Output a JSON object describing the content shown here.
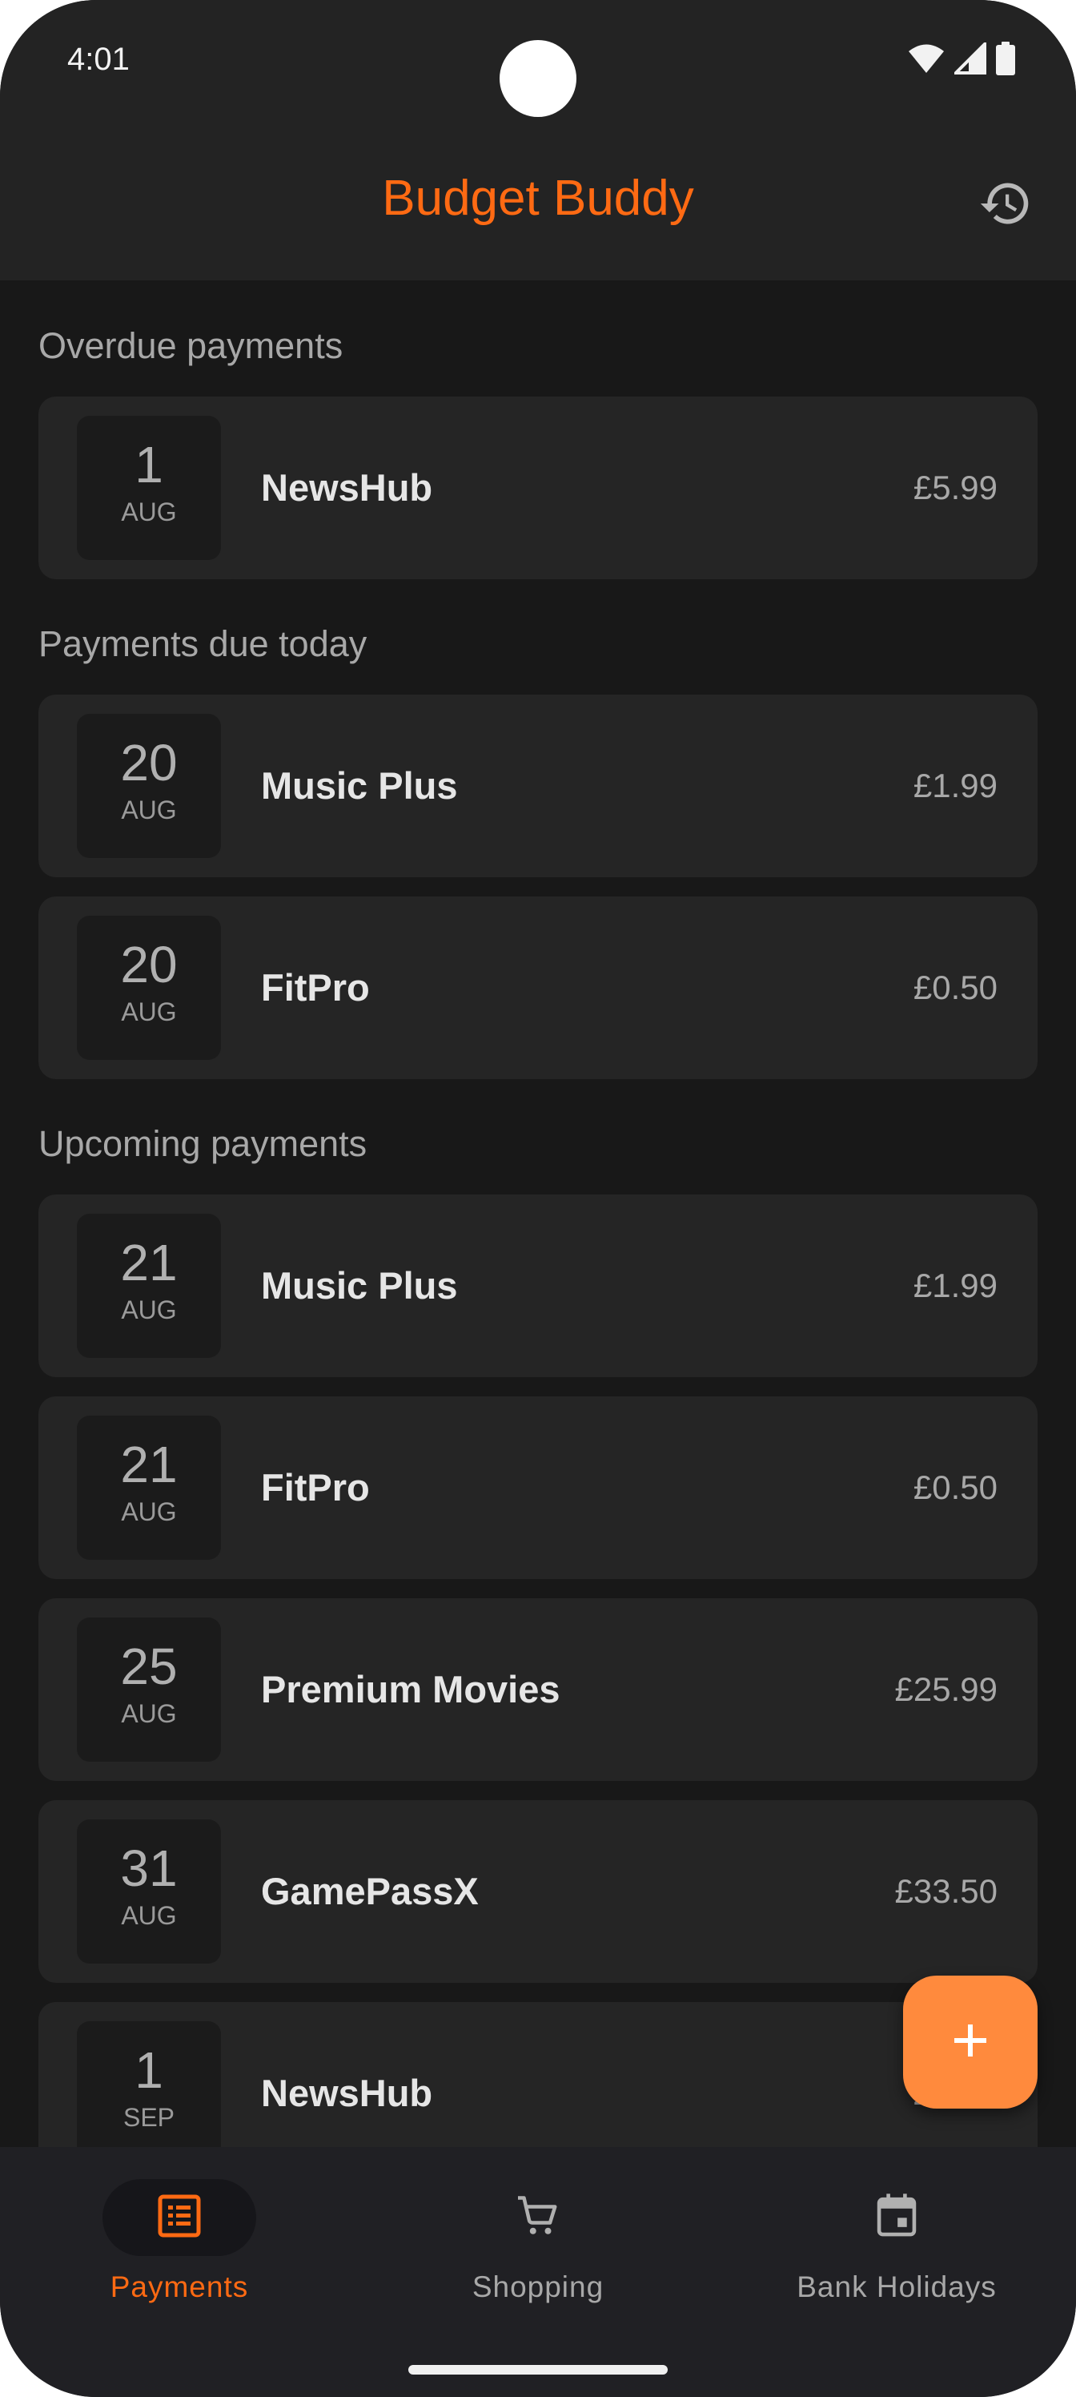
{
  "status_bar": {
    "time": "4:01"
  },
  "app_bar": {
    "title": "Budget Buddy",
    "history_icon": "history-icon"
  },
  "sections": {
    "overdue": {
      "title": "Overdue payments",
      "items": [
        {
          "day": "1",
          "month": "AUG",
          "name": "NewsHub",
          "amount": "£5.99"
        }
      ]
    },
    "today": {
      "title": "Payments due today",
      "items": [
        {
          "day": "20",
          "month": "AUG",
          "name": "Music Plus",
          "amount": "£1.99"
        },
        {
          "day": "20",
          "month": "AUG",
          "name": "FitPro",
          "amount": "£0.50"
        }
      ]
    },
    "upcoming": {
      "title": "Upcoming payments",
      "items": [
        {
          "day": "21",
          "month": "AUG",
          "name": "Music Plus",
          "amount": "£1.99"
        },
        {
          "day": "21",
          "month": "AUG",
          "name": "FitPro",
          "amount": "£0.50"
        },
        {
          "day": "25",
          "month": "AUG",
          "name": "Premium Movies",
          "amount": "£25.99"
        },
        {
          "day": "31",
          "month": "AUG",
          "name": "GamePassX",
          "amount": "£33.50"
        },
        {
          "day": "1",
          "month": "SEP",
          "name": "NewsHub",
          "amount": "£5.99"
        }
      ]
    }
  },
  "fab": {
    "icon": "plus-icon"
  },
  "bottom_nav": {
    "items": [
      {
        "label": "Payments",
        "icon": "list-icon",
        "active": true
      },
      {
        "label": "Shopping",
        "icon": "cart-icon",
        "active": false
      },
      {
        "label": "Bank Holidays",
        "icon": "calendar-icon",
        "active": false
      }
    ]
  },
  "colors": {
    "accent": "#ff6a13",
    "fab": "#ff8a3d",
    "background": "#181818",
    "card": "#252525"
  }
}
